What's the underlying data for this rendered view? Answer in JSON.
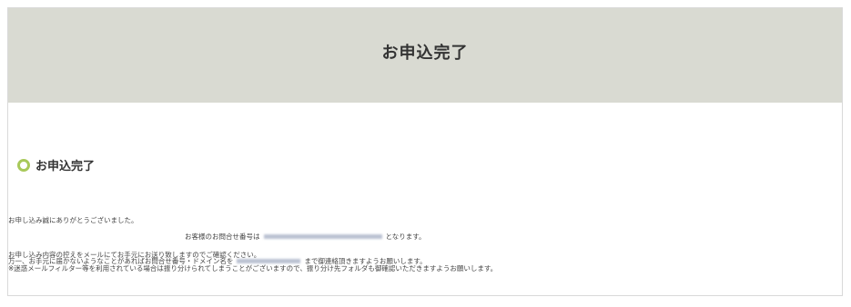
{
  "banner": {
    "title": "お申込完了"
  },
  "section": {
    "title": "お申込完了"
  },
  "messages": {
    "thanks": "お申し込み誠にありがとうございました。",
    "ref_prefix": "お客様のお問合せ番号は",
    "ref_suffix": "となります。",
    "confirm": "お申し込み内容の控えをメールにてお手元にお送り致しますのでご確認ください。",
    "notice_prefix": "万一、お手元に届かないようなことがあればお問合せ番号・ドメイン名を",
    "notice_suffix": "まで御連絡頂きますようお願いします。",
    "spam_note": "※迷惑メールフィルター等を利用されている場合は振り分けられてしまうことがございますので、振り分け先フォルダも御確認いただきますようお願いします。"
  }
}
